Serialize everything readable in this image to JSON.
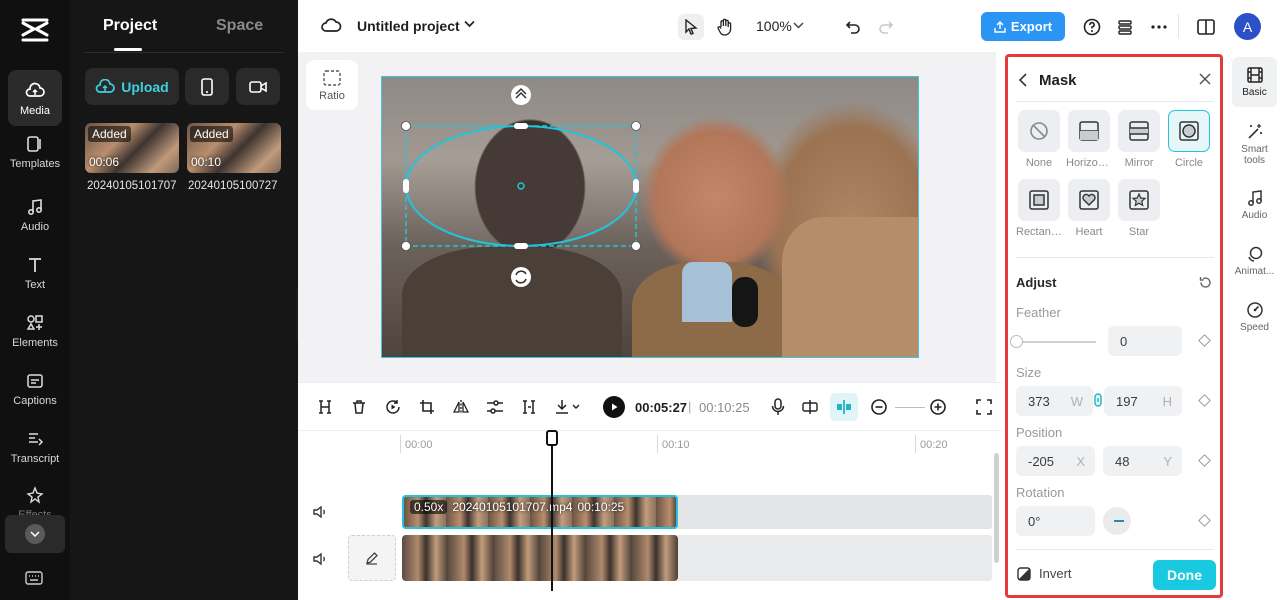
{
  "rail": {
    "items": [
      {
        "label": "Media",
        "icon": "cloud-media-icon"
      },
      {
        "label": "Templates",
        "icon": "templates-icon"
      },
      {
        "label": "Audio",
        "icon": "music-note-icon"
      },
      {
        "label": "Text",
        "icon": "text-icon"
      },
      {
        "label": "Elements",
        "icon": "elements-icon"
      },
      {
        "label": "Captions",
        "icon": "captions-icon"
      },
      {
        "label": "Transcript",
        "icon": "transcript-icon"
      },
      {
        "label": "Effects",
        "icon": "effects-star-icon"
      }
    ]
  },
  "panel": {
    "tabs": [
      "Project",
      "Space"
    ],
    "upload_label": "Upload",
    "media": [
      {
        "tag": "Added",
        "duration": "00:06",
        "name": "20240105101707"
      },
      {
        "tag": "Added",
        "duration": "00:10",
        "name": "20240105100727"
      }
    ]
  },
  "topbar": {
    "project_title": "Untitled project",
    "zoom": "100%",
    "export_label": "Export",
    "avatar_letter": "A"
  },
  "canvas": {
    "ratio_label": "Ratio"
  },
  "playback": {
    "current": "00:05:27",
    "separator": "|",
    "total": "00:10:25"
  },
  "timeline": {
    "ruler": [
      "00:00",
      "00:10",
      "00:20"
    ],
    "clip1": {
      "speed": "0.50x",
      "name": "20240105101707.mp4",
      "duration": "00:10:25"
    }
  },
  "mask": {
    "title": "Mask",
    "shapes": [
      {
        "label": "None",
        "icon": "none-icon"
      },
      {
        "label": "Horizontal",
        "icon": "horizontal-icon"
      },
      {
        "label": "Mirror",
        "icon": "mirror-icon"
      },
      {
        "label": "Circle",
        "icon": "circle-icon",
        "selected": true
      },
      {
        "label": "Rectangle",
        "icon": "rectangle-icon"
      },
      {
        "label": "Heart",
        "icon": "heart-icon"
      },
      {
        "label": "Star",
        "icon": "star-icon"
      }
    ],
    "adjust_title": "Adjust",
    "feather": {
      "label": "Feather",
      "value": "0"
    },
    "size": {
      "label": "Size",
      "w": "373",
      "w_unit": "W",
      "h": "197",
      "h_unit": "H"
    },
    "position": {
      "label": "Position",
      "x": "-205",
      "x_unit": "X",
      "y": "48",
      "y_unit": "Y"
    },
    "rotation": {
      "label": "Rotation",
      "value": "0°"
    },
    "invert_label": "Invert",
    "done_label": "Done"
  },
  "right_rail": {
    "items": [
      {
        "label": "Basic",
        "icon": "film-icon"
      },
      {
        "label": "Smart tools",
        "icon": "magic-wand-icon"
      },
      {
        "label": "Audio",
        "icon": "music-note-icon"
      },
      {
        "label": "Animat...",
        "icon": "animation-icon"
      },
      {
        "label": "Speed",
        "icon": "speed-gauge-icon"
      }
    ]
  },
  "colors": {
    "accent": "#22c4d8",
    "export": "#2b95f5",
    "highlight_border": "#e23b3b"
  }
}
